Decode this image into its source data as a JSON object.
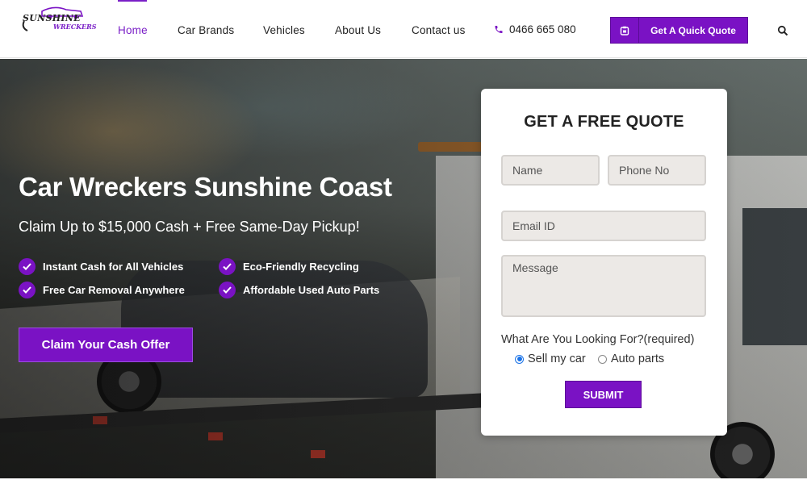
{
  "brand": {
    "logo_line1": "SUNSHINE",
    "logo_line2": "WRECKERS",
    "accent_color": "#7a12c4"
  },
  "nav": {
    "items": [
      {
        "label": "Home",
        "active": true
      },
      {
        "label": "Car Brands",
        "active": false
      },
      {
        "label": "Vehicles",
        "active": false
      },
      {
        "label": "About Us",
        "active": false
      },
      {
        "label": "Contact us",
        "active": false
      }
    ],
    "phone": "0466 665 080",
    "phone_icon": "phone-icon",
    "quote_button": "Get A Quick Quote",
    "quote_icon": "clipboard-icon",
    "search_icon": "search-icon"
  },
  "hero": {
    "title": "Car Wreckers Sunshine Coast",
    "subtitle": "Claim Up to $15,000 Cash + Free Same-Day Pickup!",
    "features": [
      "Instant Cash for All Vehicles",
      "Eco-Friendly Recycling",
      "Free Car Removal Anywhere",
      "Affordable Used Auto Parts"
    ],
    "cta": "Claim Your Cash Offer"
  },
  "form": {
    "title": "GET A FREE QUOTE",
    "name_placeholder": "Name",
    "phone_placeholder": "Phone No",
    "email_placeholder": "Email ID",
    "message_placeholder": "Message",
    "question": "What Are You Looking For?(required)",
    "options": [
      {
        "label": "Sell my car",
        "checked": true
      },
      {
        "label": "Auto parts",
        "checked": false
      }
    ],
    "submit": "SUBMIT"
  }
}
